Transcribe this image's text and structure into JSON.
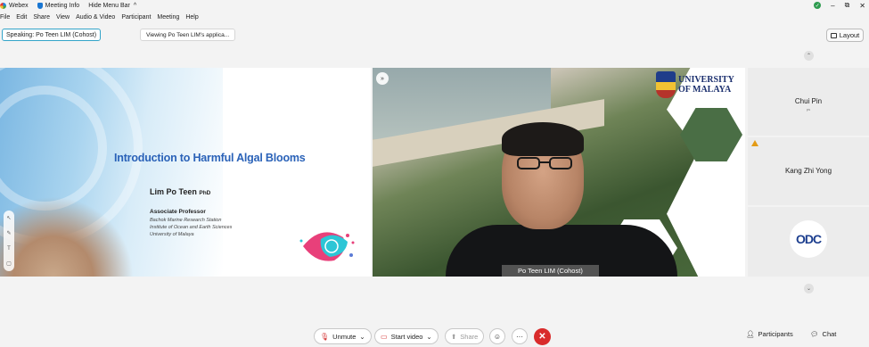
{
  "window": {
    "app_name": "Webex",
    "meeting_info": "Meeting Info",
    "hide_menu_bar": "Hide Menu Bar",
    "controls": [
      "–",
      "⧉",
      "✕"
    ]
  },
  "menu": [
    "File",
    "Edit",
    "Share",
    "View",
    "Audio & Video",
    "Participant",
    "Meeting",
    "Help"
  ],
  "speaking": {
    "label": "Speaking:",
    "name": "Po Teen LIM (Cohost)"
  },
  "sharing_notice": "Viewing Po Teen LIM's applica...",
  "layout_button": "Layout",
  "slide": {
    "title": "Introduction to Harmful Algal Blooms",
    "author": "Lim Po Teen",
    "author_suffix": "PhD",
    "role": "Associate Professor",
    "institution_lines": [
      "Bachok Marine Research Station",
      "Institute of Ocean and Earth Sciences",
      "University of Malaya"
    ]
  },
  "video": {
    "logo_text_line1": "UNIVERSITY",
    "logo_text_line2": "OF MALAYA",
    "name_tag": "Po Teen LIM (Cohost)"
  },
  "participants_panel": [
    {
      "name": "Chui Pin",
      "sub": "ps"
    },
    {
      "name": "Kang Zhi Yong",
      "warning": true
    },
    {
      "avatar": "ODC"
    }
  ],
  "bottom_bar": {
    "unmute": "Unmute",
    "start_video": "Start video",
    "share": "Share",
    "participants": "Participants",
    "chat": "Chat"
  },
  "colors": {
    "speaking_border": "#33a4c9",
    "end_call": "#d92b2b",
    "slide_title": "#2a62b8",
    "mute_red": "#d32f2f"
  }
}
